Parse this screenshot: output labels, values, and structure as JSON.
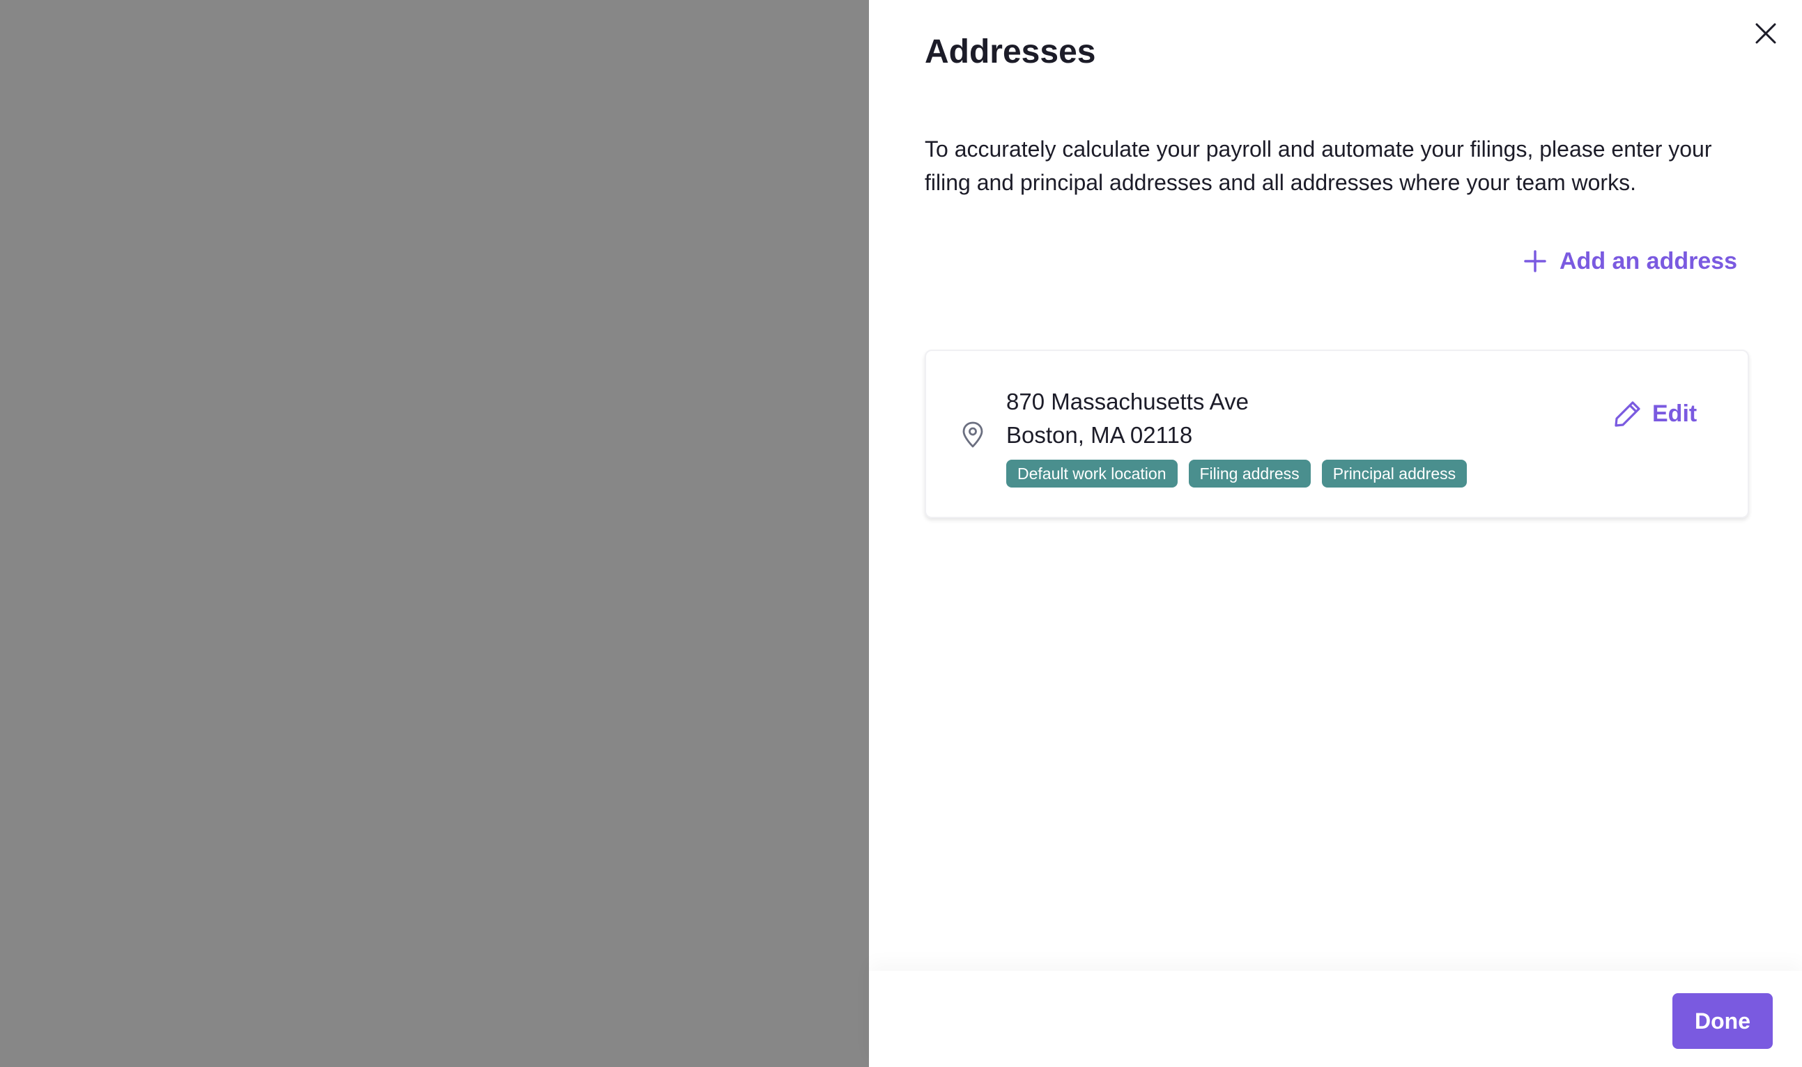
{
  "drawer": {
    "title": "Addresses",
    "description": "To accurately calculate your payroll and automate your filings, please enter your filing and principal addresses and all addresses where your team works.",
    "add_address_label": "Add an address",
    "close_icon": "close-icon",
    "add_icon": "plus-icon"
  },
  "addresses": [
    {
      "line1": "870 Massachusetts Ave",
      "line2": "Boston, MA 02118",
      "icon": "map-pin-icon",
      "badges": [
        "Default work location",
        "Filing address",
        "Principal address"
      ],
      "edit_label": "Edit",
      "edit_icon": "pencil-icon"
    }
  ],
  "footer": {
    "done_label": "Done"
  },
  "colors": {
    "overlay": "#878787",
    "accent": "#7a5ae0",
    "badge": "#4a8f8e",
    "text": "#1c1c28"
  }
}
